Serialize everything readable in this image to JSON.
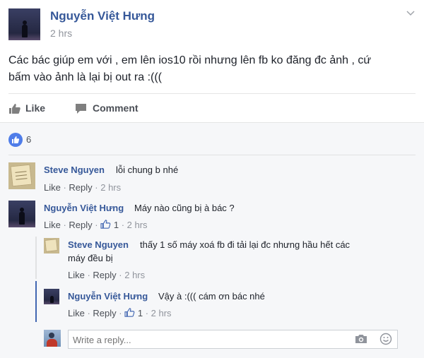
{
  "post": {
    "author": "Nguyễn Việt Hưng",
    "time": "2 hrs",
    "text_line1": "Các bác giúp em với , em lên ios10 rồi nhưng lên fb ko đăng đc ảnh , cứ",
    "text_line2": "bấm vào ảnh là lại bị out ra :((("
  },
  "actions": {
    "like": "Like",
    "comment": "Comment"
  },
  "reactions": {
    "count": "6"
  },
  "comments": [
    {
      "author": "Steve Nguyen",
      "text": "lỗi chung b nhé",
      "like": "Like",
      "reply": "Reply",
      "time": "2 hrs"
    },
    {
      "author": "Nguyễn Việt Hưng",
      "text": "Máy nào cũng bị à bác ?",
      "like": "Like",
      "reply": "Reply",
      "likes": "1",
      "time": "2 hrs"
    }
  ],
  "replies": [
    {
      "author": "Steve Nguyen",
      "text_line1": "thấy 1 số máy xoá fb đi tải lại đc nhưng hầu hết các",
      "text_line2": "máy đều bị",
      "like": "Like",
      "reply": "Reply",
      "time": "2 hrs"
    },
    {
      "author": "Nguyễn Việt Hưng",
      "text": "Vậy à :((( cám ơn bác nhé",
      "like": "Like",
      "reply": "Reply",
      "likes": "1",
      "time": "2 hrs"
    }
  ],
  "reply_box": {
    "placeholder": "Write a reply..."
  },
  "colors": {
    "link": "#365899",
    "accent": "#4267b2"
  }
}
